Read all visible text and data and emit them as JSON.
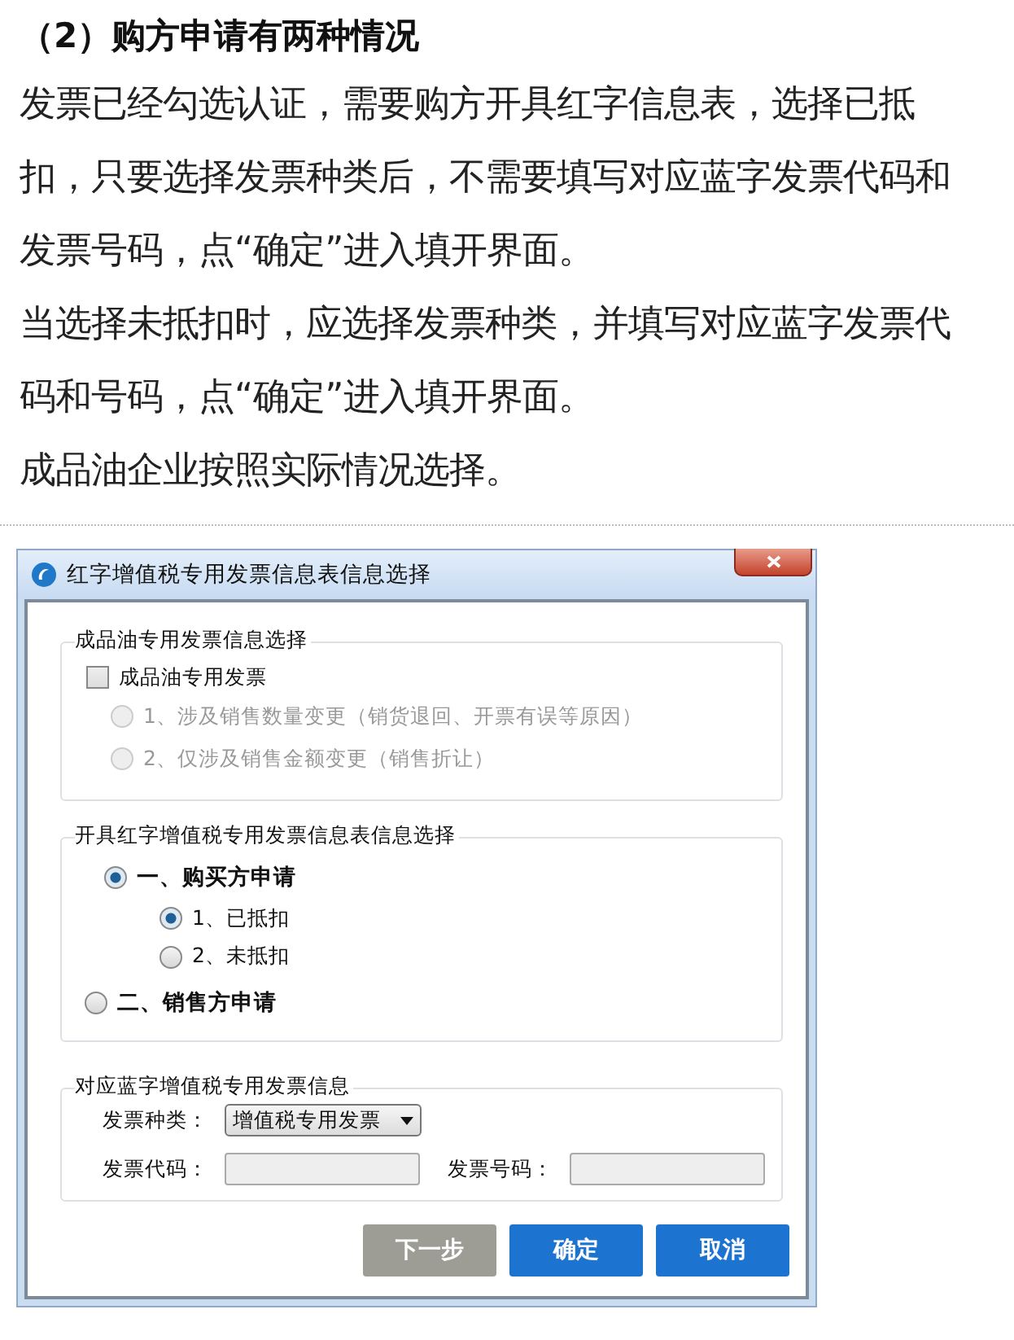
{
  "article": {
    "heading": "（2）购方申请有两种情况",
    "paragraphs": [
      "发票已经勾选认证，需要购方开具红字信息表，选择已抵扣，只要选择发票种类后，不需要填写对应蓝字发票代码和发票号码，点“确定”进入填开界面。",
      "当选择未抵扣时，应选择发票种类，并填写对应蓝字发票代码和号码，点“确定”进入填开界面。",
      "成品油企业按照实际情况选择。"
    ]
  },
  "dialog": {
    "title": "红字增值税专用发票信息表信息选择",
    "oil_group": {
      "legend": "成品油专用发票信息选择",
      "checkbox": {
        "label": "成品油专用发票",
        "checked": false
      },
      "options": [
        {
          "label": "1、涉及销售数量变更（销货退回、开票有误等原因）",
          "selected": false,
          "disabled": true
        },
        {
          "label": "2、仅涉及销售金额变更（销售折让）",
          "selected": false,
          "disabled": true
        }
      ]
    },
    "apply_group": {
      "legend": "开具红字增值税专用发票信息表信息选择",
      "options": [
        {
          "label": "一、购买方申请",
          "selected": true,
          "children": [
            {
              "label": "1、已抵扣",
              "selected": true
            },
            {
              "label": "2、未抵扣",
              "selected": false
            }
          ]
        },
        {
          "label": "二、销售方申请",
          "selected": false
        }
      ]
    },
    "blue_group": {
      "legend": "对应蓝字增值税专用发票信息",
      "type_label": "发票种类：",
      "type_value": "增值税专用发票",
      "code_label": "发票代码：",
      "code_disabled": true,
      "number_label": "发票号码：",
      "number_disabled": true
    },
    "buttons": [
      {
        "label": "下一步",
        "disabled": true
      },
      {
        "label": "确定",
        "disabled": false
      },
      {
        "label": "取消",
        "disabled": false
      }
    ]
  }
}
